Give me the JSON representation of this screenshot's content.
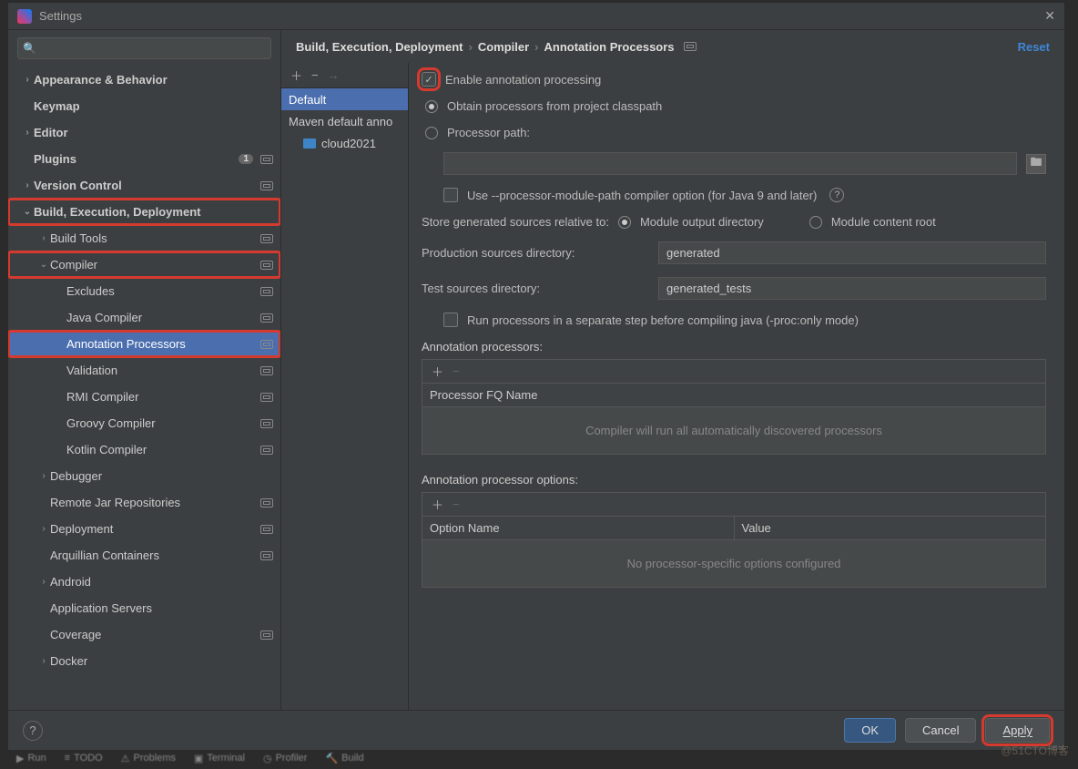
{
  "window": {
    "title": "Settings"
  },
  "search": {
    "placeholder": ""
  },
  "sidebar": [
    {
      "label": "Appearance & Behavior",
      "indent": 0,
      "chev": "›",
      "bold": true
    },
    {
      "label": "Keymap",
      "indent": 0,
      "chev": "",
      "bold": true
    },
    {
      "label": "Editor",
      "indent": 0,
      "chev": "›",
      "bold": true
    },
    {
      "label": "Plugins",
      "indent": 0,
      "chev": "",
      "bold": true,
      "badge": "1",
      "cfg": true
    },
    {
      "label": "Version Control",
      "indent": 0,
      "chev": "›",
      "bold": true,
      "cfg": true
    },
    {
      "label": "Build, Execution, Deployment",
      "indent": 0,
      "chev": "⌄",
      "bold": true,
      "highlight": true
    },
    {
      "label": "Build Tools",
      "indent": 1,
      "chev": "›",
      "cfg": true
    },
    {
      "label": "Compiler",
      "indent": 1,
      "chev": "⌄",
      "cfg": true,
      "highlight": true
    },
    {
      "label": "Excludes",
      "indent": 2,
      "chev": "",
      "cfg": true
    },
    {
      "label": "Java Compiler",
      "indent": 2,
      "chev": "",
      "cfg": true
    },
    {
      "label": "Annotation Processors",
      "indent": 2,
      "chev": "",
      "cfg": true,
      "selected": true,
      "highlight": true
    },
    {
      "label": "Validation",
      "indent": 2,
      "chev": "",
      "cfg": true
    },
    {
      "label": "RMI Compiler",
      "indent": 2,
      "chev": "",
      "cfg": true
    },
    {
      "label": "Groovy Compiler",
      "indent": 2,
      "chev": "",
      "cfg": true
    },
    {
      "label": "Kotlin Compiler",
      "indent": 2,
      "chev": "",
      "cfg": true
    },
    {
      "label": "Debugger",
      "indent": 1,
      "chev": "›"
    },
    {
      "label": "Remote Jar Repositories",
      "indent": 1,
      "chev": "",
      "cfg": true
    },
    {
      "label": "Deployment",
      "indent": 1,
      "chev": "›",
      "cfg": true
    },
    {
      "label": "Arquillian Containers",
      "indent": 1,
      "chev": "",
      "cfg": true
    },
    {
      "label": "Android",
      "indent": 1,
      "chev": "›"
    },
    {
      "label": "Application Servers",
      "indent": 1,
      "chev": ""
    },
    {
      "label": "Coverage",
      "indent": 1,
      "chev": "",
      "cfg": true
    },
    {
      "label": "Docker",
      "indent": 1,
      "chev": "›"
    }
  ],
  "crumbs": {
    "a": "Build, Execution, Deployment",
    "b": "Compiler",
    "c": "Annotation Processors",
    "reset": "Reset"
  },
  "profiles": {
    "default": "Default",
    "maven": "Maven default anno",
    "project": "cloud2021"
  },
  "panel": {
    "enable": "Enable annotation processing",
    "obtain": "Obtain processors from project classpath",
    "ppath": "Processor path:",
    "modpath": "Use --processor-module-path compiler option (for Java 9 and later)",
    "store": "Store generated sources relative to:",
    "store_a": "Module output directory",
    "store_b": "Module content root",
    "prod_label": "Production sources directory:",
    "prod_value": "generated",
    "test_label": "Test sources directory:",
    "test_value": "generated_tests",
    "separate": "Run processors in a separate step before compiling java (-proc:only mode)",
    "procs_label": "Annotation processors:",
    "procs_header": "Processor FQ Name",
    "procs_empty": "Compiler will run all automatically discovered processors",
    "opts_label": "Annotation processor options:",
    "opts_h1": "Option Name",
    "opts_h2": "Value",
    "opts_empty": "No processor-specific options configured"
  },
  "footer": {
    "ok": "OK",
    "cancel": "Cancel",
    "apply": "Apply"
  },
  "bottombar": {
    "run": "Run",
    "todo": "TODO",
    "problems": "Problems",
    "terminal": "Terminal",
    "profiler": "Profiler",
    "build": "Build"
  },
  "watermark": "@51CTO博客"
}
